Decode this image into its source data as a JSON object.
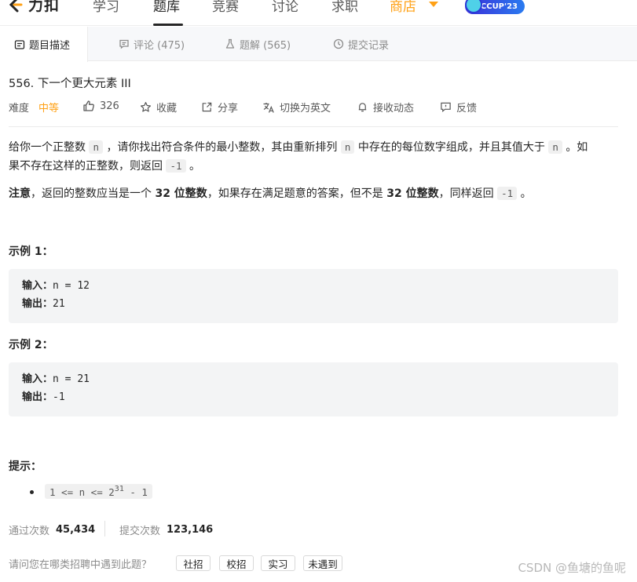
{
  "nav": {
    "logo_text": "力扣",
    "items": [
      "学习",
      "题库",
      "竞赛",
      "讨论",
      "求职",
      "商店"
    ],
    "badge": "LCCUP'23",
    "colors": {
      "accent": "#ffa116",
      "badge_start": "#3b2fd8",
      "badge_end": "#2a7bf0"
    }
  },
  "tabs": [
    {
      "label": "题目描述",
      "icon": "description-icon"
    },
    {
      "label": "评论 (475)",
      "icon": "comment-icon"
    },
    {
      "label": "题解 (565)",
      "icon": "flask-icon"
    },
    {
      "label": "提交记录",
      "icon": "clock-icon"
    }
  ],
  "problem": {
    "title": "556. 下一个更大元素 III",
    "difficulty_label": "难度",
    "difficulty": "中等",
    "likes": "326",
    "favorite": "收藏",
    "share": "分享",
    "translate": "切换为英文",
    "subscribe": "接收动态",
    "feedback": "反馈"
  },
  "description": {
    "p1_a": "给你一个正整数",
    "p1_code1": "n",
    "p1_b": "，请你找出符合条件的最小整数，其由重新排列",
    "p1_code2": "n",
    "p1_c": "中存在的每位数字组成，并且其值大于",
    "p1_code3": "n",
    "p1_d": "。如",
    "p1_line2_a": "果不存在这样的正整数，则返回",
    "p1_code4": "-1",
    "p1_line2_b": "。",
    "p2_bold1": "注意",
    "p2_a": "，返回的整数应当是一个",
    "p2_bold2": "32 位整数",
    "p2_b": "，如果存在满足题意的答案，但不是",
    "p2_bold3": "32 位整数",
    "p2_c": "，同样返回",
    "p2_code": "-1",
    "p2_d": "。"
  },
  "examples": [
    {
      "heading": "示例 1：",
      "input_label": "输入：",
      "input": "n = 12",
      "output_label": "输出：",
      "output": "21"
    },
    {
      "heading": "示例 2：",
      "input_label": "输入：",
      "input": "n = 21",
      "output_label": "输出：",
      "output": "-1"
    }
  ],
  "hints": {
    "heading": "提示：",
    "c1": "1 <= n <= 2",
    "sup": "31",
    "c2": " - 1"
  },
  "stats": {
    "accepted_label": "通过次数",
    "accepted": "45,434",
    "submitted_label": "提交次数",
    "submitted": "123,146"
  },
  "company": {
    "question": "请问您在哪类招聘中遇到此题？",
    "options": [
      "社招",
      "校招",
      "实习",
      "未遇到"
    ]
  },
  "watermark": "CSDN @鱼塘的鱼呢"
}
